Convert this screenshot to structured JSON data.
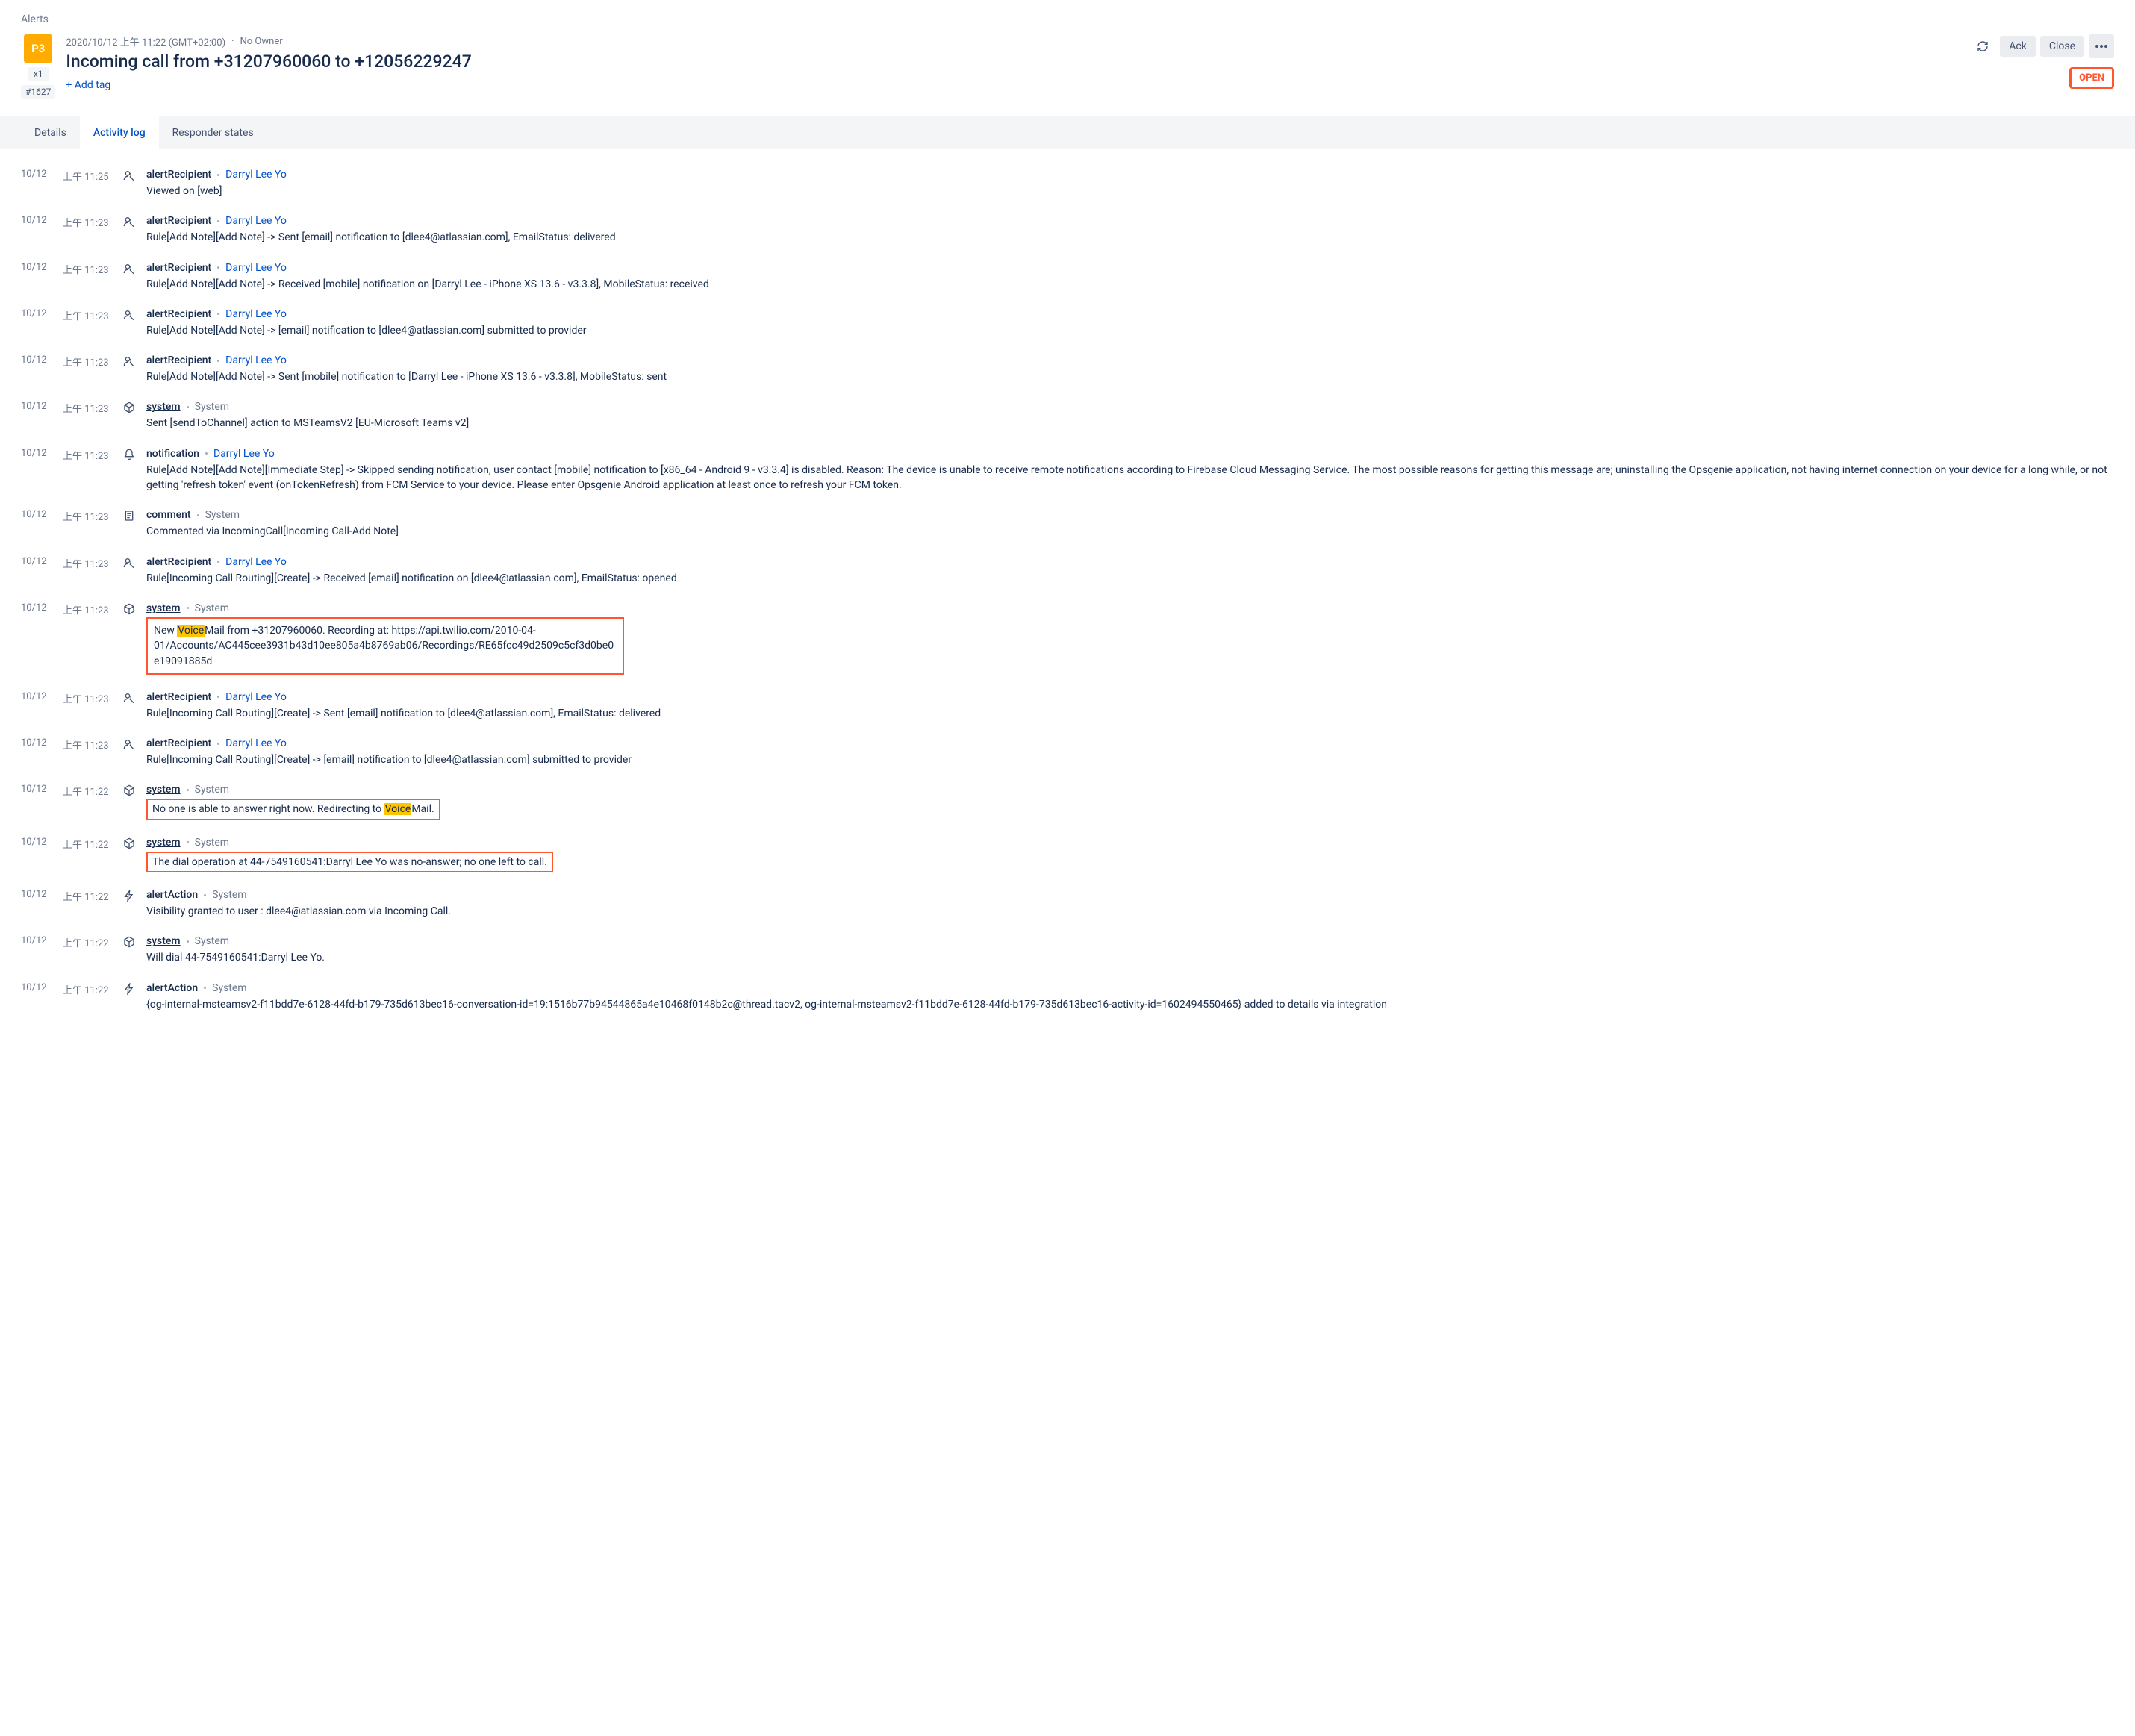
{
  "breadcrumb": "Alerts",
  "priority": "P3",
  "x_count": "x1",
  "tiny_id": "#1627",
  "timestamp_meta": "2020/10/12 上午 11:22 (GMT+02:00)",
  "owner": "No Owner",
  "title": "Incoming call from +31207960060 to +12056229247",
  "add_tag": "+ Add tag",
  "actions": {
    "ack": "Ack",
    "close": "Close"
  },
  "status": "OPEN",
  "tabs": {
    "details": "Details",
    "activity": "Activity log",
    "responder": "Responder states"
  },
  "log": [
    {
      "date": "10/12",
      "time": "上午 11:25",
      "icon": "user-remove",
      "type": "alertRecipient",
      "actor": "Darryl Lee Yo",
      "actor_link": true,
      "desc": "Viewed on [web]"
    },
    {
      "date": "10/12",
      "time": "上午 11:23",
      "icon": "user-remove",
      "type": "alertRecipient",
      "actor": "Darryl Lee Yo",
      "actor_link": true,
      "desc": "Rule[Add Note][Add Note] -> Sent [email] notification to [dlee4@atlassian.com], EmailStatus: delivered"
    },
    {
      "date": "10/12",
      "time": "上午 11:23",
      "icon": "user-remove",
      "type": "alertRecipient",
      "actor": "Darryl Lee Yo",
      "actor_link": true,
      "desc": "Rule[Add Note][Add Note] -> Received [mobile] notification on [Darryl Lee - iPhone XS 13.6 - v3.3.8], MobileStatus: received"
    },
    {
      "date": "10/12",
      "time": "上午 11:23",
      "icon": "user-remove",
      "type": "alertRecipient",
      "actor": "Darryl Lee Yo",
      "actor_link": true,
      "desc": "Rule[Add Note][Add Note] -> [email] notification to [dlee4@atlassian.com] submitted to provider"
    },
    {
      "date": "10/12",
      "time": "上午 11:23",
      "icon": "user-remove",
      "type": "alertRecipient",
      "actor": "Darryl Lee Yo",
      "actor_link": true,
      "desc": "Rule[Add Note][Add Note] -> Sent [mobile] notification to [Darryl Lee - iPhone XS 13.6 - v3.3.8], MobileStatus: sent"
    },
    {
      "date": "10/12",
      "time": "上午 11:23",
      "icon": "cube",
      "type": "system",
      "underline": true,
      "actor": "System",
      "actor_link": false,
      "desc": "Sent [sendToChannel] action to MSTeamsV2 [EU-Microsoft Teams v2]"
    },
    {
      "date": "10/12",
      "time": "上午 11:23",
      "icon": "bell",
      "type": "notification",
      "actor": "Darryl Lee Yo",
      "actor_link": true,
      "desc": "Rule[Add Note][Add Note][Immediate Step] -> Skipped sending notification, user contact [mobile] notification to [x86_64 - Android 9 - v3.3.4] is disabled. Reason: The device is unable to receive remote notifications according to Firebase Cloud Messaging Service. The most possible reasons for getting this message are; uninstalling the Opsgenie application, not having internet connection on your device for a long while, or not getting 'refresh token' event (onTokenRefresh) from FCM Service to your device. Please enter Opsgenie Android application at least once to refresh your FCM token."
    },
    {
      "date": "10/12",
      "time": "上午 11:23",
      "icon": "document",
      "type": "comment",
      "actor": "System",
      "actor_link": false,
      "desc": "Commented via IncomingCall[Incoming Call-Add Note]"
    },
    {
      "date": "10/12",
      "time": "上午 11:23",
      "icon": "user-remove",
      "type": "alertRecipient",
      "actor": "Darryl Lee Yo",
      "actor_link": true,
      "desc": "Rule[Incoming Call Routing][Create] -> Received [email] notification on [dlee4@atlassian.com], EmailStatus: opened"
    },
    {
      "date": "10/12",
      "time": "上午 11:23",
      "icon": "cube",
      "type": "system",
      "underline": true,
      "actor": "System",
      "actor_link": false,
      "desc_kind": "voicemail_block",
      "desc_parts": {
        "pre": "New ",
        "hl": "Voice",
        "post": "Mail from +31207960060. Recording at: https://api.twilio.com/2010-04-01/Accounts/AC445cee3931b43d10ee805a4b8769ab06/Recordings/RE65fcc49d2509c5cf3d0be0e19091885d"
      }
    },
    {
      "date": "10/12",
      "time": "上午 11:23",
      "icon": "user-remove",
      "type": "alertRecipient",
      "actor": "Darryl Lee Yo",
      "actor_link": true,
      "desc": "Rule[Incoming Call Routing][Create] -> Sent [email] notification to [dlee4@atlassian.com], EmailStatus: delivered"
    },
    {
      "date": "10/12",
      "time": "上午 11:23",
      "icon": "user-remove",
      "type": "alertRecipient",
      "actor": "Darryl Lee Yo",
      "actor_link": true,
      "desc": "Rule[Incoming Call Routing][Create] -> [email] notification to [dlee4@atlassian.com] submitted to provider"
    },
    {
      "date": "10/12",
      "time": "上午 11:22",
      "icon": "cube",
      "type": "system",
      "underline": true,
      "actor": "System",
      "actor_link": false,
      "desc_kind": "redirect_box",
      "desc_parts": {
        "pre": "No one is able to answer right now. Redirecting to ",
        "hl": "Voice",
        "post": "Mail."
      }
    },
    {
      "date": "10/12",
      "time": "上午 11:22",
      "icon": "cube",
      "type": "system",
      "underline": true,
      "actor": "System",
      "actor_link": false,
      "desc_kind": "inline_box",
      "desc": "The dial operation at 44-7549160541:Darryl Lee Yo was no-answer; no one left to call."
    },
    {
      "date": "10/12",
      "time": "上午 11:22",
      "icon": "bolt",
      "type": "alertAction",
      "actor": "System",
      "actor_link": false,
      "desc": "Visibility granted to user : dlee4@atlassian.com via Incoming Call."
    },
    {
      "date": "10/12",
      "time": "上午 11:22",
      "icon": "cube",
      "type": "system",
      "underline": true,
      "actor": "System",
      "actor_link": false,
      "desc": "Will dial 44-7549160541:Darryl Lee Yo."
    },
    {
      "date": "10/12",
      "time": "上午 11:22",
      "icon": "bolt",
      "type": "alertAction",
      "actor": "System",
      "actor_link": false,
      "desc": "{og-internal-msteamsv2-f11bdd7e-6128-44fd-b179-735d613bec16-conversation-id=19:1516b77b94544865a4e10468f0148b2c@thread.tacv2, og-internal-msteamsv2-f11bdd7e-6128-44fd-b179-735d613bec16-activity-id=1602494550465} added to details via integration"
    }
  ]
}
